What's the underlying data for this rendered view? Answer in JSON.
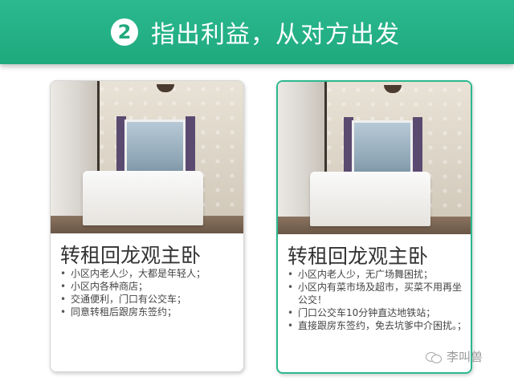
{
  "header": {
    "step_number": "2",
    "title": "指出利益，从对方出发"
  },
  "cards": [
    {
      "title": "转租回龙观主卧",
      "bullets": [
        "小区内老人少，大都是年轻人；",
        "小区内各种商店；",
        "交通便利，门口有公交车；",
        "同意转租后跟房东签约；"
      ]
    },
    {
      "title": "转租回龙观主卧",
      "bullets": [
        "小区内老人少，无广场舞困扰；",
        "小区内有菜市场及超市，买菜不用再坐公交！",
        "门口公交车10分钟直达地铁站；",
        "直接跟房东签约，免去坑爹中介困扰。；"
      ]
    }
  ],
  "watermark": {
    "text": "李叫兽",
    "icon": "wechat-icon"
  },
  "colors": {
    "banner": "#22ad82",
    "highlight_border": "#2bb98f"
  }
}
